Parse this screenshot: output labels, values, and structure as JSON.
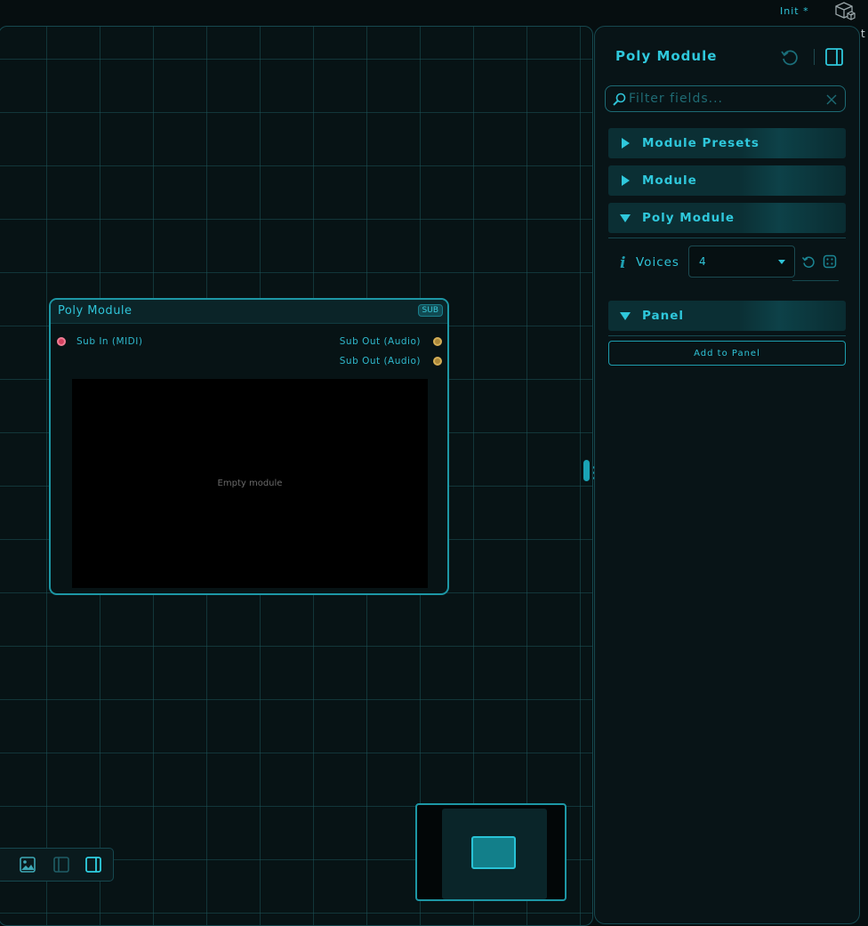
{
  "topbar": {
    "project_name": "Init *",
    "project_icon": "cube-icon",
    "edge_text": "t"
  },
  "node": {
    "title": "Poly Module",
    "badge": "SUB",
    "input_port": "Sub In (MIDI)",
    "output_ports": [
      "Sub Out (Audio)",
      "Sub Out (Audio)"
    ],
    "empty_text": "Empty module"
  },
  "inspector": {
    "title": "Poly Module",
    "filter_placeholder": "Filter fields...",
    "sections": [
      {
        "label": "Module Presets",
        "expanded": false
      },
      {
        "label": "Module",
        "expanded": false
      },
      {
        "label": "Poly Module",
        "expanded": true
      },
      {
        "label": "Panel",
        "expanded": true
      }
    ],
    "voices": {
      "label": "Voices",
      "value": "4",
      "info_icon": "i"
    },
    "add_to_panel_label": "Add to Panel"
  },
  "toolbar": {
    "icons": [
      "image-icon",
      "left-sidebar-icon",
      "right-sidebar-icon"
    ]
  },
  "colors": {
    "accent": "#2fc4d8",
    "background": "#060e10",
    "midi_port": "#d2415e",
    "audio_port": "#a8863a"
  }
}
